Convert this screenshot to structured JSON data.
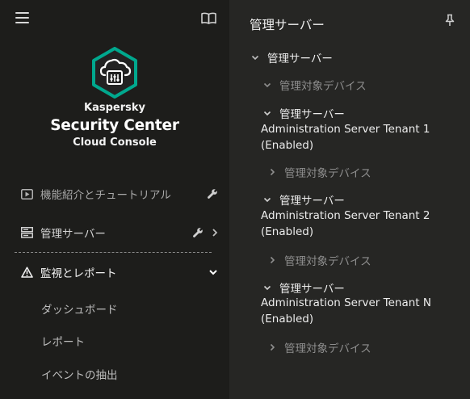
{
  "sidebar": {
    "brand": {
      "line1": "Kaspersky",
      "line2": "Security Center",
      "line3": "Cloud Console"
    },
    "nav": [
      {
        "label": "機能紹介とチュートリアル",
        "icon": "play-icon",
        "right_icons": [
          "wrench-icon"
        ]
      },
      {
        "label": "管理サーバー",
        "icon": "server-icon",
        "right_icons": [
          "wrench-icon",
          "chevron-right-icon"
        ]
      },
      {
        "label": "監視とレポート",
        "icon": "warning-icon",
        "right_icons": [
          "chevron-down-icon"
        ],
        "expanded": true
      }
    ],
    "sub_items": [
      {
        "label": "ダッシュボード"
      },
      {
        "label": "レポート"
      },
      {
        "label": "イベントの抽出"
      }
    ]
  },
  "panel": {
    "title": "管理サーバー",
    "tree": {
      "root": "管理サーバー",
      "root_child": "管理対象デバイス",
      "tenants": [
        {
          "label": "管理サーバー",
          "name": "Administration Server Tenant 1",
          "status": "(Enabled)",
          "child": "管理対象デバイス"
        },
        {
          "label": "管理サーバー",
          "name": "Administration Server Tenant 2",
          "status": "(Enabled)",
          "child": "管理対象デバイス"
        },
        {
          "label": "管理サーバー",
          "name": "Administration Server Tenant N",
          "status": "(Enabled)",
          "child": "管理対象デバイス"
        }
      ]
    }
  },
  "colors": {
    "sidebar_bg": "#1d1d1b",
    "panel_bg": "#262624",
    "brand_accent": "#00a88e"
  }
}
